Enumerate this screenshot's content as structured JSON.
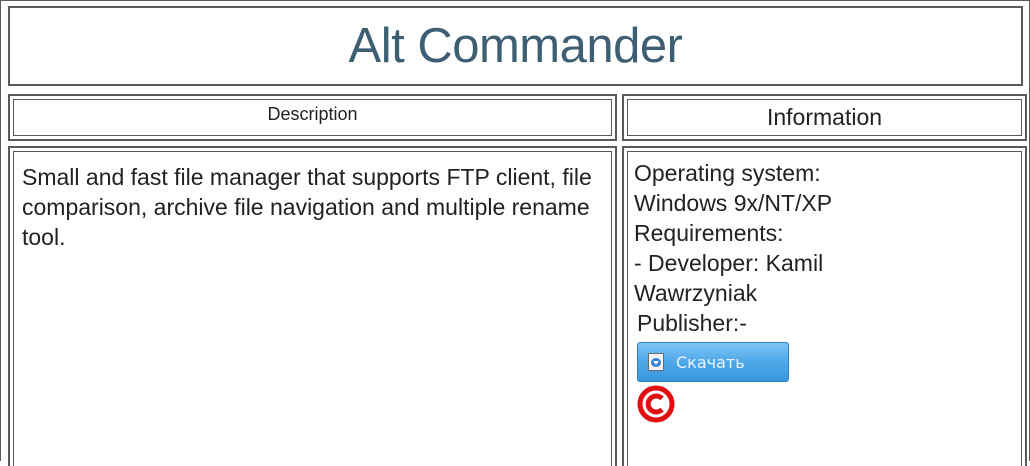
{
  "title": "Alt Commander",
  "headers": {
    "description": "Description",
    "information": "Information"
  },
  "description_text": "Small and fast file manager that supports FTP client, file comparison, archive file navigation and multiple rename tool.",
  "info": {
    "os_label": "Operating system:",
    "os_value": "Windows 9x/NT/XP",
    "requirements_label": "Requirements:",
    "developer_line": "- Developer: Kamil",
    "developer_line2": "Wawrzyniak",
    "publisher": "Publisher:-"
  },
  "download_button": {
    "label": "Скачать",
    "icon": "download-icon"
  },
  "copyright_icon": "copyright-icon",
  "colors": {
    "title": "#3e5f73",
    "button": "#4ea8ea",
    "copyright": "#e01010",
    "border": "#5a5a5a"
  }
}
